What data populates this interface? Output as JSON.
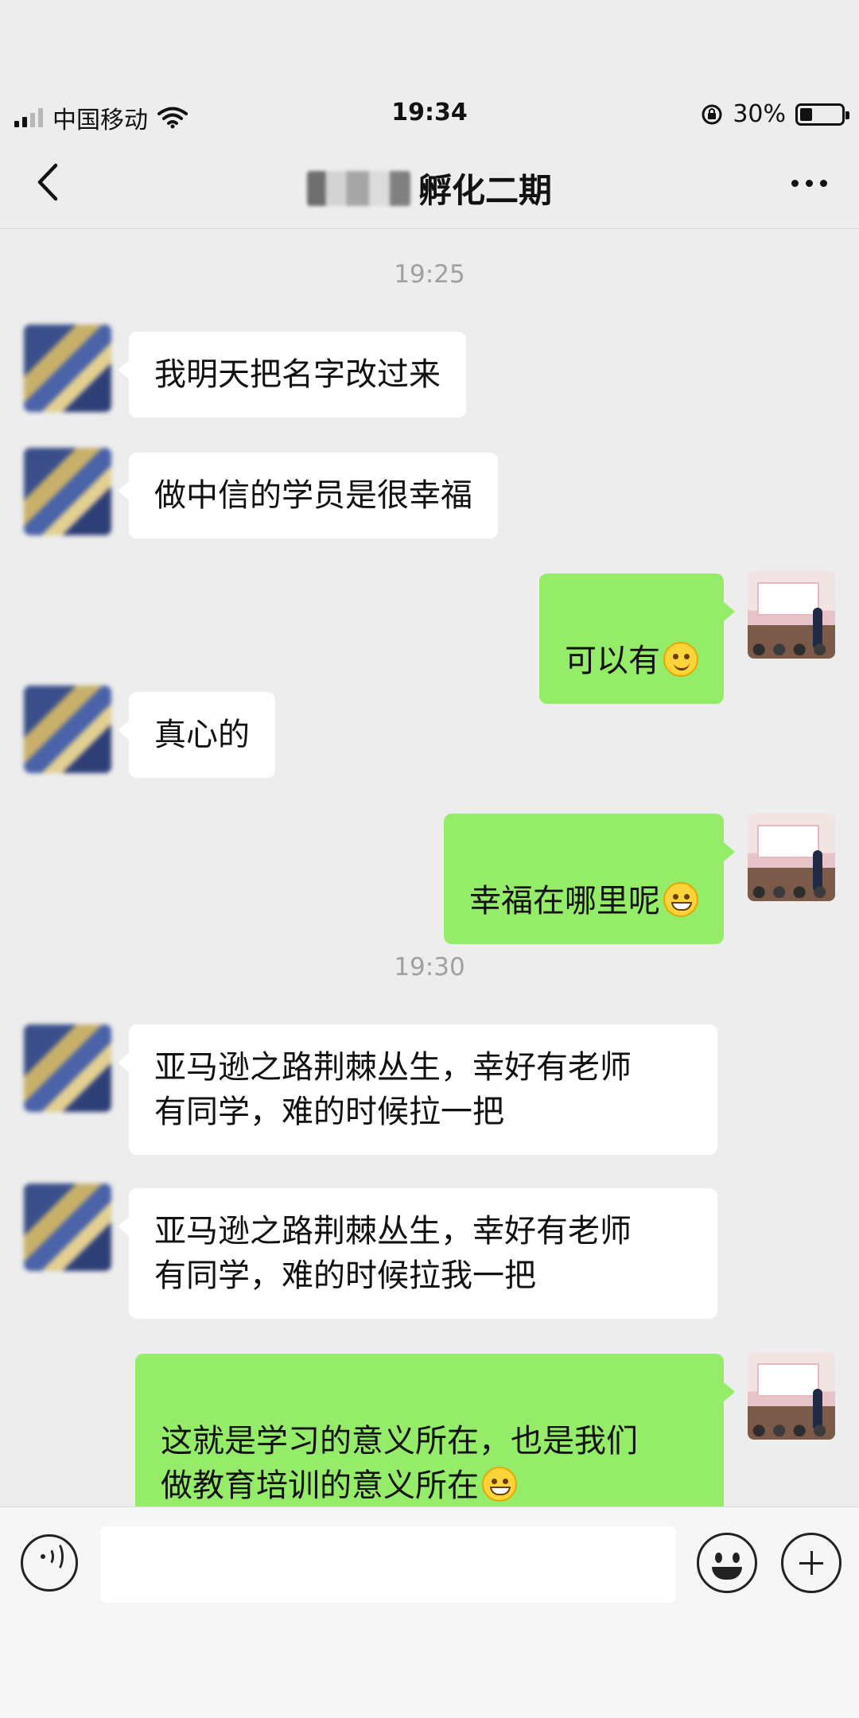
{
  "status_bar": {
    "carrier": "中国移动",
    "time": "19:34",
    "battery_text": "30%",
    "battery_level": 0.3,
    "icons": [
      "signal-icon",
      "wifi-icon",
      "orientation-lock-icon",
      "battery-icon"
    ]
  },
  "header": {
    "title": "孵化二期",
    "back_icon": "chevron-left-icon",
    "more_icon": "more-dots-icon"
  },
  "messages": [
    {
      "type": "time",
      "text": "19:25"
    },
    {
      "type": "in",
      "text": "我明天把名字改过来"
    },
    {
      "type": "in",
      "text": "做中信的学员是很幸福"
    },
    {
      "type": "out",
      "text": "可以有",
      "emoji": "smile"
    },
    {
      "type": "in",
      "text": "真心的"
    },
    {
      "type": "out",
      "text": "幸福在哪里呢",
      "emoji": "grin"
    },
    {
      "type": "time",
      "text": "19:30"
    },
    {
      "type": "in",
      "text": "亚马逊之路荆棘丛生，幸好有老师\n有同学，难的时候拉一把"
    },
    {
      "type": "in",
      "text": "亚马逊之路荆棘丛生，幸好有老师\n有同学，难的时候拉我一把"
    },
    {
      "type": "out",
      "text": "这就是学习的意义所在，也是我们\n做教育培训的意义所在",
      "emoji": "grin"
    }
  ],
  "input_bar": {
    "placeholder": "",
    "icons": [
      "voice-icon",
      "emoji-icon",
      "plus-icon"
    ]
  },
  "colors": {
    "background": "#ededed",
    "outgoing_bubble": "#95ec69",
    "incoming_bubble": "#ffffff"
  }
}
